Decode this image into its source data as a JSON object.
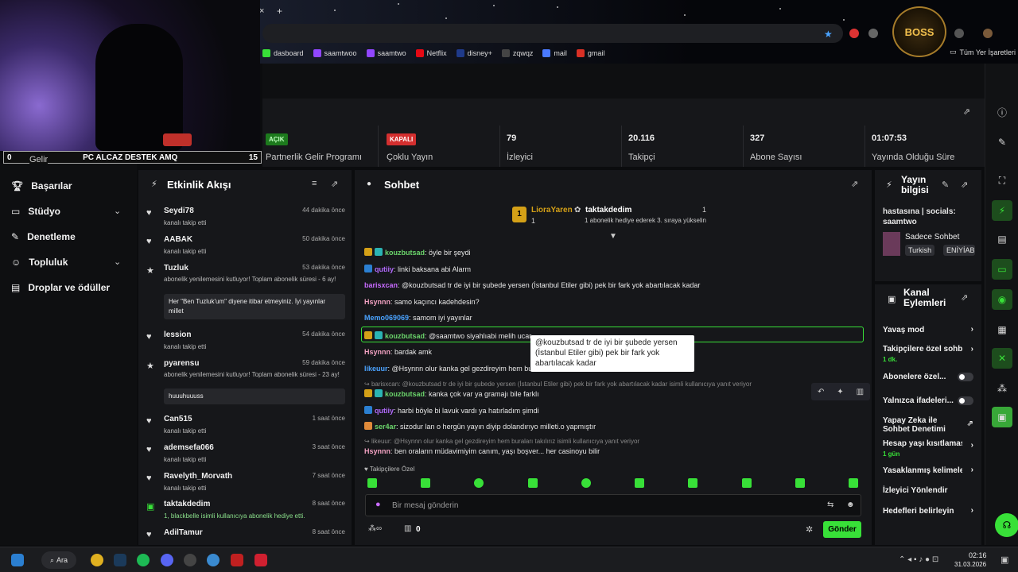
{
  "browser": {
    "bookmarks": [
      "dasboard",
      "saamtwoo",
      "saamtwo",
      "Netflix",
      "disney+",
      "zqwqz",
      "mail",
      "gmail"
    ],
    "all_bookmarks": "Tüm Yer İşaretleri",
    "logo_text": "BOSS"
  },
  "overlay": {
    "left_num": "0",
    "title": "PC ALCAZ DESTEK AMQ",
    "right_num": "15",
    "income_label": "Gelir"
  },
  "nav": {
    "items": [
      {
        "label": "Başarılar"
      },
      {
        "label": "Stüdyo"
      },
      {
        "label": "Denetleme"
      },
      {
        "label": "Topluluk"
      },
      {
        "label": "Droplar ve ödüller"
      }
    ]
  },
  "stats": [
    {
      "value": "AÇIK",
      "label": "Partnerlik Gelir Programı"
    },
    {
      "value": "KAPALI",
      "label": "Çoklu Yayın"
    },
    {
      "value": "79",
      "label": "İzleyici"
    },
    {
      "value": "20.116",
      "label": "Takipçi"
    },
    {
      "value": "327",
      "label": "Abone Sayısı"
    },
    {
      "value": "01:07:53",
      "label": "Yayında Olduğu Süre"
    }
  ],
  "colors": {
    "accent": "#38e038",
    "danger": "#d32f2f",
    "panel": "#16171a"
  },
  "feed": {
    "title": "Etkinlik Akışı",
    "items": [
      {
        "name": "Seydi78",
        "time": "44 dakika önce",
        "sub": "kanalı takip etti"
      },
      {
        "name": "AABAK",
        "time": "50 dakika önce",
        "sub": "kanalı takip etti"
      },
      {
        "name": "Tuzluk",
        "time": "53 dakika önce",
        "sub": "abonelik yenilemesini kutluyor! Toplam abonelik süresi - 6 ay!",
        "quote": "Her \"Ben Tuzluk'um\" diyene itibar etmeyiniz. İyi yayınlar millet"
      },
      {
        "name": "lession",
        "time": "54 dakika önce",
        "sub": "kanalı takip etti"
      },
      {
        "name": "pyarensu",
        "time": "59 dakika önce",
        "sub": "abonelik yenilemesini kutluyor! Toplam abonelik süresi - 23 ay!",
        "quote": "huuuhuuuss"
      },
      {
        "name": "Can515",
        "time": "1 saat önce",
        "sub": "kanalı takip etti"
      },
      {
        "name": "ademsefa066",
        "time": "3 saat önce",
        "sub": "kanalı takip etti"
      },
      {
        "name": "Ravelyth_Morvath",
        "time": "7 saat önce",
        "sub": "kanalı takip etti"
      },
      {
        "name": "taktakdedim",
        "time": "8 saat önce",
        "sub": "1, blackbelle isimli kullanıcıya abonelik hediye etti."
      },
      {
        "name": "AdilTamur",
        "time": "8 saat önce",
        "sub": ""
      }
    ]
  },
  "chat": {
    "title": "Sohbet",
    "pinned": {
      "user1": "LioraYaren",
      "count1": "1",
      "user2": "taktakdedim",
      "count2": "1",
      "text": "1 abonelik hediye ederek 3. sıraya yükselin"
    },
    "messages": [
      {
        "user": "kouzbutsad",
        "text": ": öyle bir şeydi",
        "color": "#6bd56b"
      },
      {
        "user": "qutiiy",
        "text": ": linki baksana abi Alarm",
        "color": "#b36bff"
      },
      {
        "user": "barisxcan",
        "text": ": @kouzbutsad tr de iyi bir şubede yersen (İstanbul Etiler gibi) pek bir fark yok abartılacak kadar",
        "color": "#c86bff"
      },
      {
        "user": "Hsynnn",
        "text": ": samo kaçıncı kadehdesin?",
        "color": "#f0a0c0"
      },
      {
        "user": "Memo069069",
        "text": ": samom iyi yayınlar",
        "color": "#4aa3ff"
      },
      {
        "user": "kouzbutsad",
        "text": ": @saamtwo siyahlıabi melih ucar",
        "color": "#6bd56b"
      },
      {
        "user": "Hsynnn",
        "text": ": bardak amk",
        "color": "#f0a0c0"
      },
      {
        "user": "likeuur",
        "text": ": @Hsynnn olur kanka gel gezdireyim hem bu",
        "color": "#4aa3ff"
      },
      {
        "user": "kouzbutsad",
        "text": ": kanka çok var ya gramajı bile farklı",
        "color": "#6bd56b"
      },
      {
        "user": "qutiiy",
        "text": ": harbi böyle bi lavuk vardı ya hatırladım şimdi",
        "color": "#b36bff"
      },
      {
        "user": "ser4ar",
        "text": ": sizodur lan o hergün yayın diyip dolandırıyo milleti.o yapmıştır",
        "color": "#6bd56b"
      },
      {
        "user": "Hsynnn",
        "text": ": ben oraların müdavimiyim canım, yaşı boşver... her casinoyu bilir",
        "color": "#f0a0c0"
      }
    ],
    "reply1": "barisxcan: @kouzbutsad tr de iyi bir şubede yersen (İstanbul Etiler gibi) pek bir fark yok abartılacak kadar isimli kullanıcıya yanıt veriyor",
    "reply2": "likeuur: @Hsynnn olur kanka gel gezdireyim hem buraları takılırız isimli kullanıcıya yanıt veriyor",
    "tooltip": "@kouzbutsad tr de iyi bir şubede yersen (İstanbul Etiler gibi) pek bir fark yok abartılacak kadar",
    "followers_only": "Takipçilere Özel",
    "input_placeholder": "Bir mesaj gönderin",
    "points": "0",
    "send": "Gönder"
  },
  "info": {
    "title": "Yayın bilgisi",
    "desc": "hastasına | socials: saamtwo",
    "category": "Sadece Sohbet",
    "tag1": "Turkish",
    "tag2": "ENİYİAB"
  },
  "actions": {
    "title": "Kanal Eylemleri",
    "items": [
      {
        "label": "Yavaş mod"
      },
      {
        "label": "Takipçilere özel sohbet",
        "sub": "1 dk."
      },
      {
        "label": "Abonelere özel..."
      },
      {
        "label": "Yalnızca ifadeleri..."
      },
      {
        "label": "Yapay Zeka ile Sohbet Denetimi"
      },
      {
        "label": "Hesap yaşı kısıtlaması",
        "sub": "1 gün"
      },
      {
        "label": "Yasaklanmış kelimeler"
      },
      {
        "label": "İzleyici Yönlendir"
      },
      {
        "label": "Hedefleri belirleyin"
      }
    ]
  },
  "taskbar": {
    "search": "Ara",
    "time": "02:16",
    "date": "31.03.2026"
  }
}
